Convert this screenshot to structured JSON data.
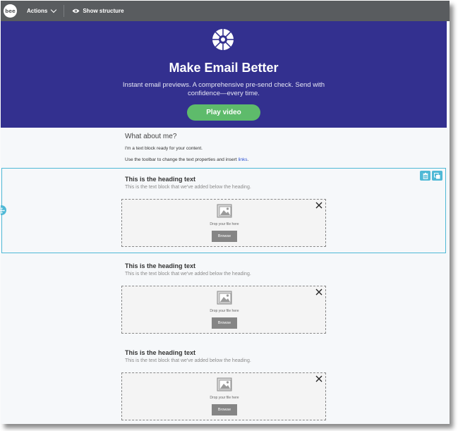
{
  "toolbar": {
    "logo_text": "bee",
    "actions_label": "Actions",
    "show_structure_label": "Show structure"
  },
  "hero": {
    "title": "Make Email Better",
    "subtitle": "Instant email previews. A comprehensive pre-send check. Send with confidence—every time.",
    "button_label": "Play video"
  },
  "about": {
    "title": "What about me?",
    "line1": "I'm a text block ready for your content.",
    "line2_prefix": "Use the toolbar to change the text properties and insert ",
    "line2_link": "links",
    "line2_suffix": "."
  },
  "blocks": [
    {
      "heading": "This is the heading text",
      "text": "This is the text block that we've added below the heading.",
      "drop_label": "Drop your file here",
      "browse_label": "Browse"
    },
    {
      "heading": "This is the heading text",
      "text": "This is the text block that we've added below the heading.",
      "drop_label": "Drop your file here",
      "browse_label": "Browse"
    },
    {
      "heading": "This is the heading text",
      "text": "This is the text block that we've added below the heading.",
      "drop_label": "Drop your file here",
      "browse_label": "Browse"
    }
  ],
  "icons": {
    "logo": "bee-logo-icon",
    "chevron": "chevron-down-icon",
    "eye": "eye-icon",
    "hero_logo": "wheel-logo-icon",
    "delete": "trash-icon",
    "duplicate": "duplicate-icon",
    "drag": "move-arrows-icon",
    "close": "close-icon",
    "image": "image-placeholder-icon"
  },
  "colors": {
    "toolbar": "#595c5f",
    "hero_bg": "#33308f",
    "play_button": "#5ebb6b",
    "selection": "#4fb9d6",
    "link": "#2a4fd1"
  }
}
